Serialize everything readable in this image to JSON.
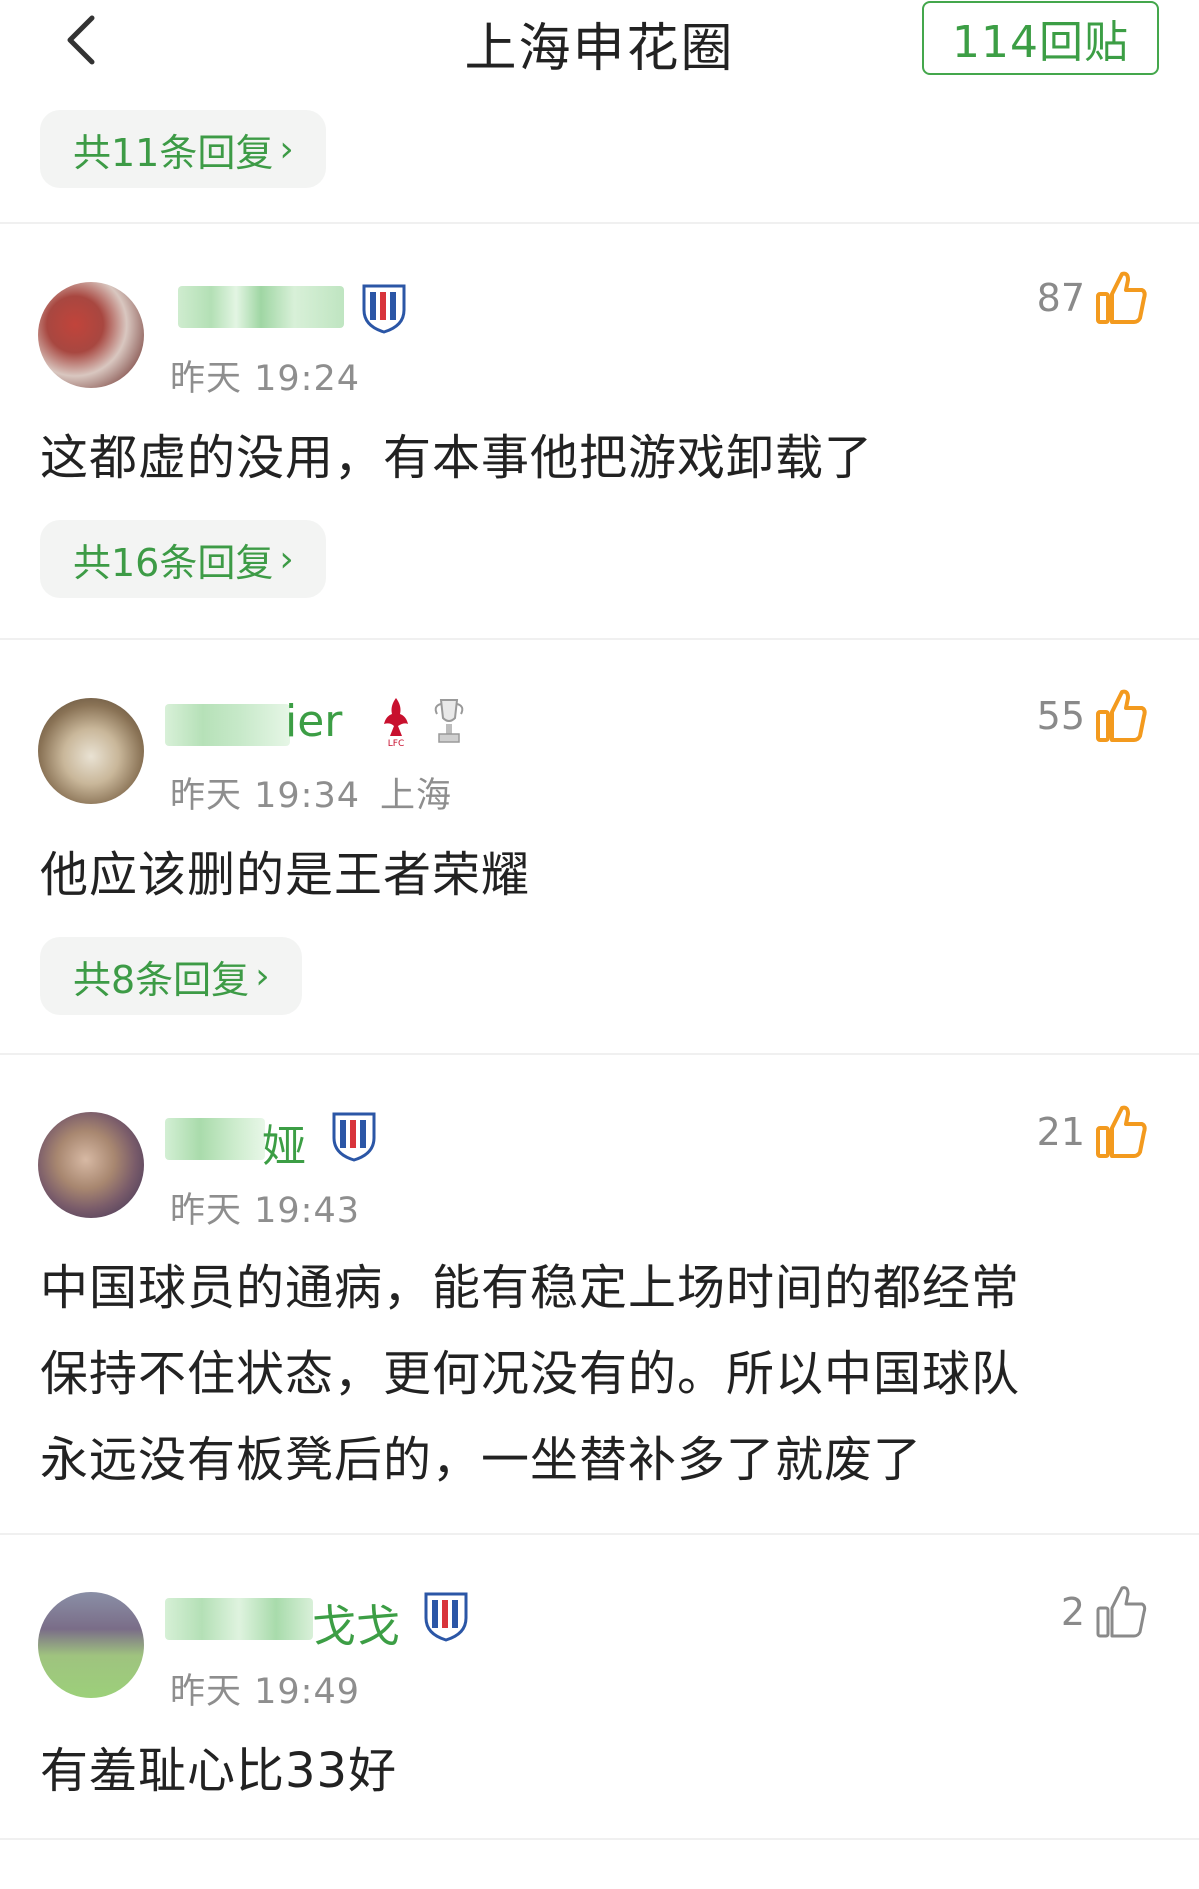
{
  "header": {
    "title": "上海申花圈",
    "reply_count_label": "114回贴"
  },
  "top_reply_pill": "共11条回复",
  "comments": [
    {
      "name_visible": "",
      "time": "昨天 19:24",
      "location": "",
      "likes": "87",
      "liked": true,
      "text_lines": [
        "这都虚的没用，有本事他把游戏卸载了"
      ],
      "reply_pill": "共16条回复"
    },
    {
      "name_visible": "ier",
      "time": "昨天 19:34",
      "location": "上海",
      "likes": "55",
      "liked": true,
      "text_lines": [
        "他应该删的是王者荣耀"
      ],
      "reply_pill": "共8条回复"
    },
    {
      "name_visible": "娅",
      "time": "昨天 19:43",
      "location": "",
      "likes": "21",
      "liked": true,
      "text_lines": [
        "中国球员的通病，能有稳定上场时间的都经常",
        "保持不住状态，更何况没有的。所以中国球队",
        "永远没有板凳后的，一坐替补多了就废了"
      ],
      "reply_pill": ""
    },
    {
      "name_visible": "戈戈",
      "time": "昨天 19:49",
      "location": "",
      "likes": "2",
      "liked": false,
      "text_lines": [
        "有羞耻心比33好"
      ],
      "reply_pill": ""
    }
  ],
  "colors": {
    "green": "#3c9e45",
    "orange": "#f39a1e",
    "gray": "#8e8e8e"
  }
}
